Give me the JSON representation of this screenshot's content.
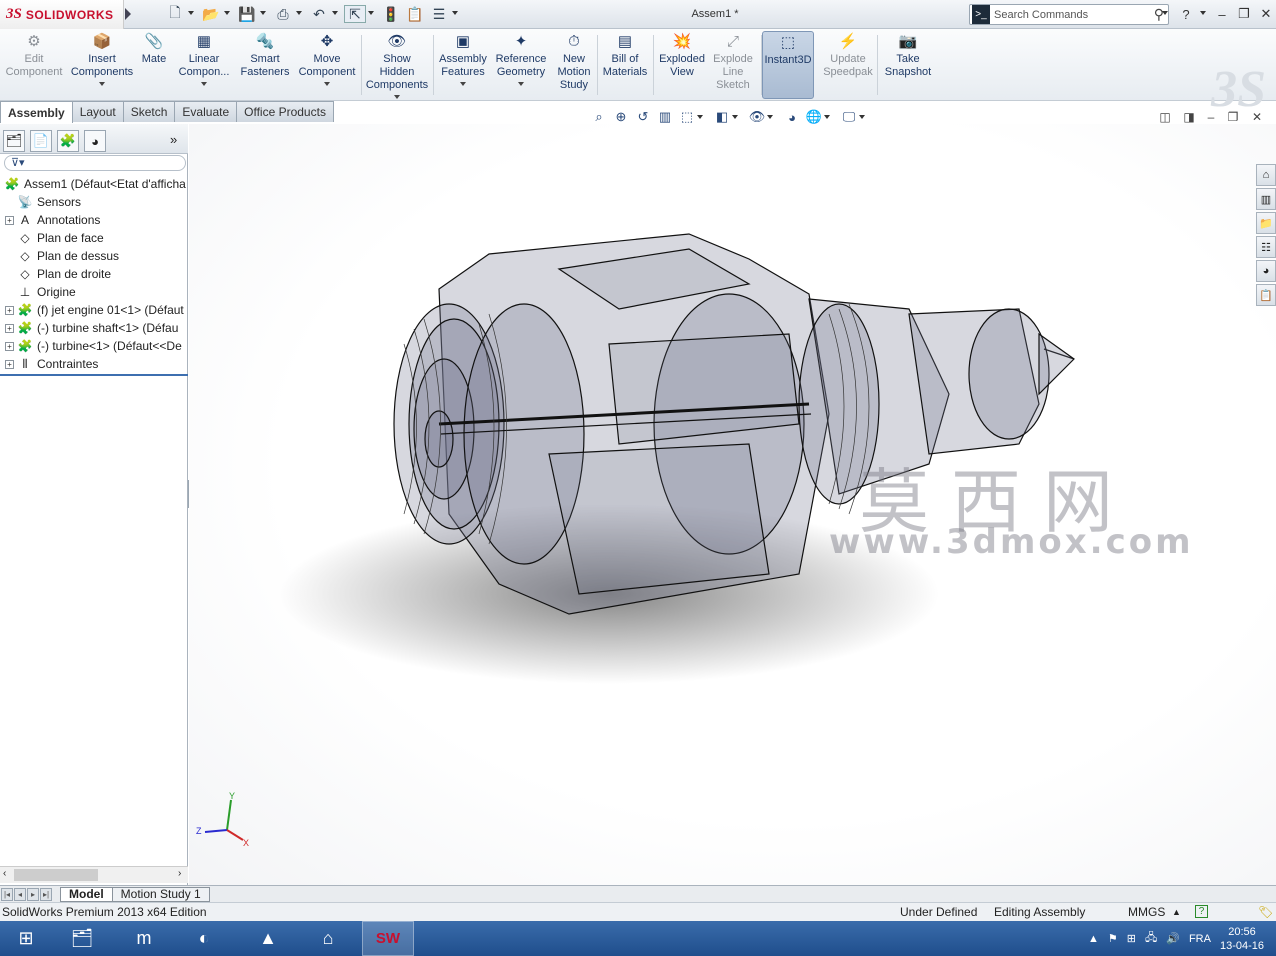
{
  "app": {
    "logo_text": "SOLIDWORKS",
    "document_title": "Assem1 *",
    "search_placeholder": "Search Commands"
  },
  "command_manager": {
    "items": [
      {
        "label": "Edit\nComponent",
        "icon": "edit-component-icon"
      },
      {
        "label": "Insert\nComponents",
        "icon": "insert-components-icon"
      },
      {
        "label": "Mate",
        "icon": "mate-icon"
      },
      {
        "label": "Linear\nCompon...",
        "icon": "linear-pattern-icon"
      },
      {
        "label": "Smart\nFasteners",
        "icon": "smart-fasteners-icon"
      },
      {
        "label": "Move\nComponent",
        "icon": "move-component-icon"
      },
      {
        "label": "Show\nHidden\nComponents",
        "icon": "show-hidden-icon"
      },
      {
        "label": "Assembly\nFeatures",
        "icon": "assembly-features-icon"
      },
      {
        "label": "Reference\nGeometry",
        "icon": "reference-geometry-icon"
      },
      {
        "label": "New\nMotion\nStudy",
        "icon": "motion-study-icon"
      },
      {
        "label": "Bill of\nMaterials",
        "icon": "bom-icon"
      },
      {
        "label": "Exploded\nView",
        "icon": "exploded-view-icon"
      },
      {
        "label": "Explode\nLine\nSketch",
        "icon": "explode-line-icon"
      },
      {
        "label": "Instant3D",
        "icon": "instant3d-icon"
      },
      {
        "label": "Update\nSpeedpak",
        "icon": "speedpak-icon"
      },
      {
        "label": "Take\nSnapshot",
        "icon": "snapshot-icon"
      }
    ]
  },
  "tabs": [
    "Assembly",
    "Layout",
    "Sketch",
    "Evaluate",
    "Office Products"
  ],
  "feature_tree": {
    "items": [
      {
        "label": "Assem1  (Défaut<Etat d'afficha",
        "icon": "assembly-icon"
      },
      {
        "label": "Sensors",
        "icon": "sensors-icon"
      },
      {
        "label": "Annotations",
        "icon": "annotations-icon"
      },
      {
        "label": "Plan de face",
        "icon": "plane-icon"
      },
      {
        "label": "Plan de dessus",
        "icon": "plane-icon"
      },
      {
        "label": "Plan de droite",
        "icon": "plane-icon"
      },
      {
        "label": "Origine",
        "icon": "origin-icon"
      },
      {
        "label": "(f) jet engine 01<1> (Défaut",
        "icon": "part-icon"
      },
      {
        "label": "(-) turbine shaft<1> (Défau",
        "icon": "part-icon"
      },
      {
        "label": "(-) turbine<1> (Défaut<<De",
        "icon": "part-icon"
      },
      {
        "label": "Contraintes",
        "icon": "mates-icon"
      }
    ]
  },
  "viewport": {
    "watermark_cn": "莫西网",
    "watermark_url": "www.3dmox.com",
    "triad": {
      "x": "X",
      "y": "Y",
      "z": "Z"
    }
  },
  "bottom_tabs": [
    "Model",
    "Motion Study 1"
  ],
  "status": {
    "edition": "SolidWorks Premium 2013 x64 Edition",
    "state": "Under Defined",
    "mode": "Editing Assembly",
    "units": "MMGS"
  },
  "taskbar": {
    "language": "FRA",
    "time": "20:56",
    "date": "13-04-16"
  },
  "colors": {
    "brand": "#c8102e",
    "accent": "#1f3a66"
  }
}
